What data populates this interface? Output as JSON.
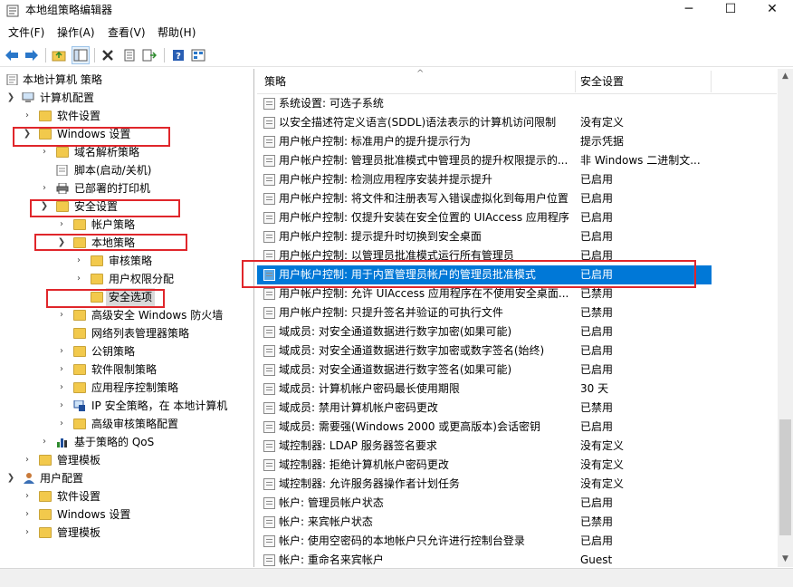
{
  "window": {
    "title": "本地组策略编辑器",
    "minimize_glyph": "─",
    "maximize_glyph": "☐",
    "close_glyph": "✕"
  },
  "menu": {
    "items": [
      {
        "label": "文件(F)"
      },
      {
        "label": "操作(A)"
      },
      {
        "label": "查看(V)"
      },
      {
        "label": "帮助(H)"
      }
    ]
  },
  "toolbar": {
    "buttons": [
      "back-arrow-icon",
      "forward-arrow-icon",
      "up-folder-icon",
      "show-hide-tree-icon",
      "delete-icon",
      "properties-icon",
      "export-list-icon",
      "help-icon",
      "view-icon"
    ]
  },
  "tree": {
    "items": [
      {
        "label": "本地计算机 策略"
      },
      {
        "label": "计算机配置"
      },
      {
        "label": "软件设置"
      },
      {
        "label": "Windows 设置"
      },
      {
        "label": "域名解析策略"
      },
      {
        "label": "脚本(启动/关机)"
      },
      {
        "label": "已部署的打印机"
      },
      {
        "label": "安全设置"
      },
      {
        "label": "帐户策略"
      },
      {
        "label": "本地策略"
      },
      {
        "label": "审核策略"
      },
      {
        "label": "用户权限分配"
      },
      {
        "label": "安全选项"
      },
      {
        "label": "高级安全 Windows 防火墙"
      },
      {
        "label": "网络列表管理器策略"
      },
      {
        "label": "公钥策略"
      },
      {
        "label": "软件限制策略"
      },
      {
        "label": "应用程序控制策略"
      },
      {
        "label": "IP 安全策略，在 本地计算机"
      },
      {
        "label": "高级审核策略配置"
      },
      {
        "label": "基于策略的 QoS"
      },
      {
        "label": "管理模板"
      },
      {
        "label": "用户配置"
      },
      {
        "label": "软件设置"
      },
      {
        "label": "Windows 设置"
      },
      {
        "label": "管理模板"
      }
    ]
  },
  "list": {
    "columns": {
      "policy": "策略",
      "setting": "安全设置"
    },
    "rows": [
      {
        "name": "系统设置: 可选子系统",
        "value": ""
      },
      {
        "name": "以安全描述符定义语言(SDDL)语法表示的计算机访问限制",
        "value": "没有定义"
      },
      {
        "name": "用户帐户控制: 标准用户的提升提示行为",
        "value": "提示凭据"
      },
      {
        "name": "用户帐户控制: 管理员批准模式中管理员的提升权限提示的...",
        "value": "非 Windows 二进制文..."
      },
      {
        "name": "用户帐户控制: 检测应用程序安装并提示提升",
        "value": "已启用"
      },
      {
        "name": "用户帐户控制: 将文件和注册表写入错误虚拟化到每用户位置",
        "value": "已启用"
      },
      {
        "name": "用户帐户控制: 仅提升安装在安全位置的 UIAccess 应用程序",
        "value": "已启用"
      },
      {
        "name": "用户帐户控制: 提示提升时切换到安全桌面",
        "value": "已启用"
      },
      {
        "name": "用户帐户控制: 以管理员批准模式运行所有管理员",
        "value": "已启用"
      },
      {
        "name": "用户帐户控制: 用于内置管理员帐户的管理员批准模式",
        "value": "已启用"
      },
      {
        "name": "用户帐户控制: 允许 UIAccess 应用程序在不使用安全桌面...",
        "value": "已禁用"
      },
      {
        "name": "用户帐户控制: 只提升签名并验证的可执行文件",
        "value": "已禁用"
      },
      {
        "name": "域成员: 对安全通道数据进行数字加密(如果可能)",
        "value": "已启用"
      },
      {
        "name": "域成员: 对安全通道数据进行数字加密或数字签名(始终)",
        "value": "已启用"
      },
      {
        "name": "域成员: 对安全通道数据进行数字签名(如果可能)",
        "value": "已启用"
      },
      {
        "name": "域成员: 计算机帐户密码最长使用期限",
        "value": "30 天"
      },
      {
        "name": "域成员: 禁用计算机帐户密码更改",
        "value": "已禁用"
      },
      {
        "name": "域成员: 需要强(Windows 2000 或更高版本)会话密钥",
        "value": "已启用"
      },
      {
        "name": "域控制器: LDAP 服务器签名要求",
        "value": "没有定义"
      },
      {
        "name": "域控制器: 拒绝计算机帐户密码更改",
        "value": "没有定义"
      },
      {
        "name": "域控制器: 允许服务器操作者计划任务",
        "value": "没有定义"
      },
      {
        "name": "帐户: 管理员帐户状态",
        "value": "已启用"
      },
      {
        "name": "帐户: 来宾帐户状态",
        "value": "已禁用"
      },
      {
        "name": "帐户: 使用空密码的本地帐户只允许进行控制台登录",
        "value": "已启用"
      },
      {
        "name": "帐户: 重命名来宾帐户",
        "value": "Guest"
      }
    ]
  },
  "colors": {
    "selection": "#0078d7",
    "annotation": "#e0262b",
    "folder": "#f2c94c"
  }
}
